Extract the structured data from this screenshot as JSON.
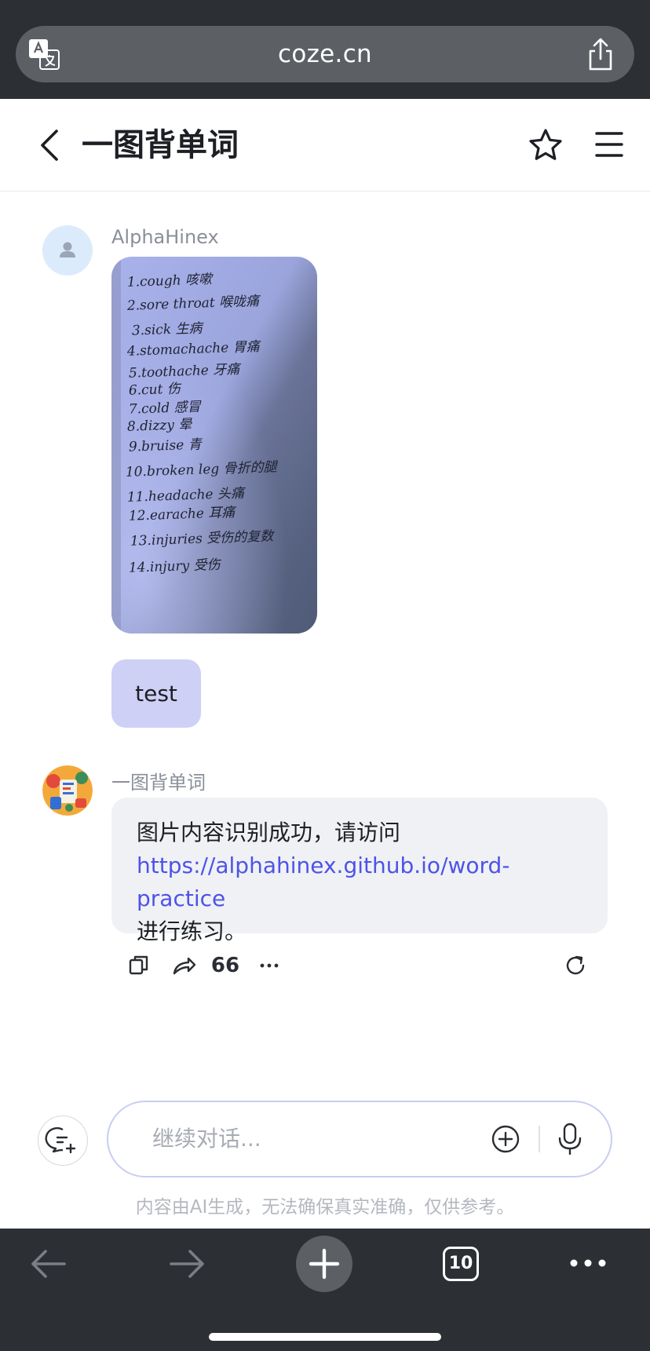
{
  "browser": {
    "url": "coze.cn",
    "tab_count": "10"
  },
  "header": {
    "title": "一图背单词"
  },
  "messages": {
    "user": {
      "name": "AlphaHinex",
      "photo_lines": [
        "1.cough 咳嗽",
        "2.sore throat 喉咙痛",
        "3.sick 生病",
        "4.stomachache 胃痛",
        "5.toothache 牙痛",
        "6.cut 伤",
        "7.cold 感冒",
        "8.dizzy 晕",
        "9.bruise 青",
        "10.broken leg 骨折的腿",
        "11.headache 头痛",
        "12.earache 耳痛",
        "13.injuries 受伤的复数",
        "14.injury 受伤"
      ],
      "text": "test"
    },
    "bot": {
      "name": "一图背单词",
      "line1": "图片内容识别成功，请访问",
      "link": "https://alphahinex.github.io/word-practice",
      "line3": "进行练习。",
      "action_quote": "66"
    }
  },
  "input": {
    "placeholder": "继续对话..."
  },
  "disclaimer": "内容由AI生成，无法确保真实准确，仅供参考。",
  "colors": {
    "accent": "#4d53e8",
    "user_bubble": "#cfd0f6",
    "bot_bubble": "#f0f1f4",
    "browser_chrome": "#2c3034"
  },
  "icons": {
    "browser": [
      "translate-icon",
      "share-icon"
    ],
    "header": [
      "back-icon",
      "star-icon",
      "menu-icon"
    ],
    "actions": [
      "copy-icon",
      "share-message-icon",
      "quote-icon",
      "more-icon",
      "regenerate-icon"
    ],
    "input": [
      "new-chat-icon",
      "add-attachment-icon",
      "microphone-icon"
    ],
    "bottom": [
      "back-arrow-icon",
      "forward-arrow-icon",
      "new-tab-icon",
      "tabs-icon",
      "more-menu-icon"
    ]
  }
}
